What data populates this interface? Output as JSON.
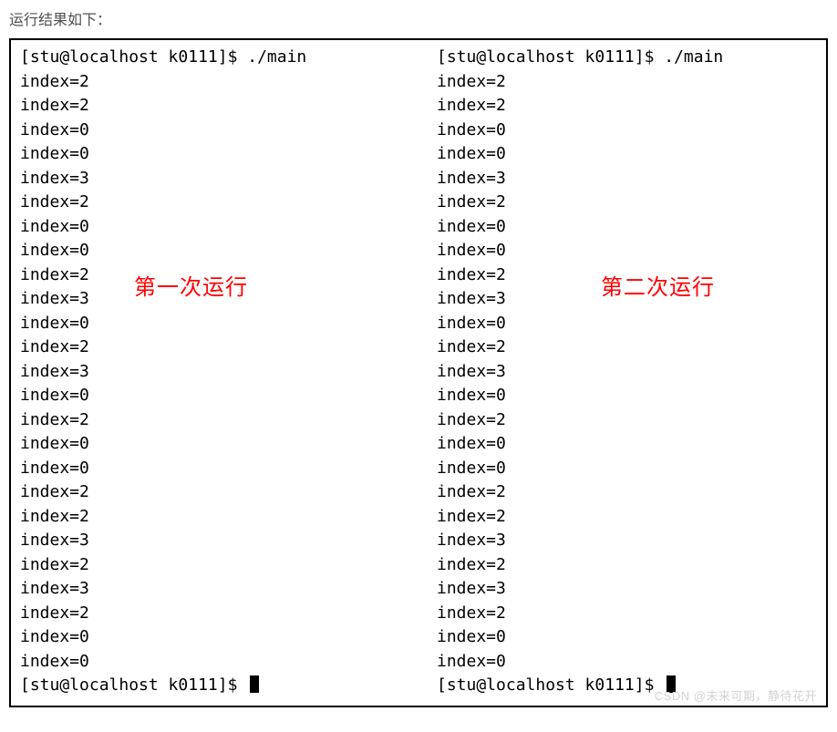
{
  "heading": "运行结果如下：",
  "left": {
    "annotation": "第一次运行",
    "prompt_start": "[stu@localhost k0111]$ ./main",
    "prompt_end": "[stu@localhost k0111]$ ",
    "lines": [
      "index=2",
      "index=2",
      "index=0",
      "index=0",
      "index=3",
      "index=2",
      "index=0",
      "index=0",
      "index=2",
      "index=3",
      "index=0",
      "index=2",
      "index=3",
      "index=0",
      "index=2",
      "index=0",
      "index=0",
      "index=2",
      "index=2",
      "index=3",
      "index=2",
      "index=3",
      "index=2",
      "index=0",
      "index=0"
    ]
  },
  "right": {
    "annotation": "第二次运行",
    "prompt_start": "[stu@localhost k0111]$ ./main",
    "prompt_end": "[stu@localhost k0111]$ ",
    "lines": [
      "index=2",
      "index=2",
      "index=0",
      "index=0",
      "index=3",
      "index=2",
      "index=0",
      "index=0",
      "index=2",
      "index=3",
      "index=0",
      "index=2",
      "index=3",
      "index=0",
      "index=2",
      "index=0",
      "index=0",
      "index=2",
      "index=2",
      "index=3",
      "index=2",
      "index=3",
      "index=2",
      "index=0",
      "index=0"
    ]
  },
  "watermark": "CSDN @未来可期，静待花开"
}
